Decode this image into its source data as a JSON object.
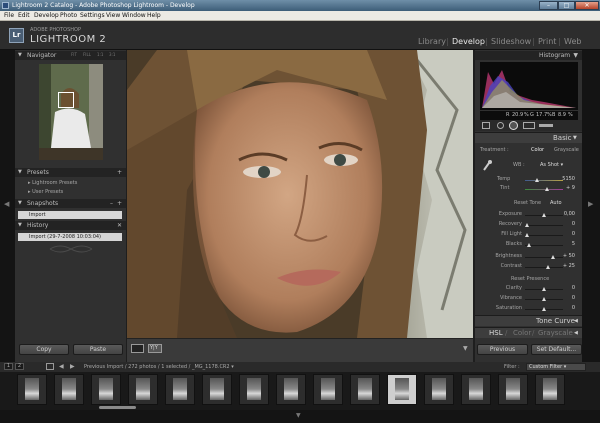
{
  "window": {
    "title": "Lightroom 2 Catalog - Adobe Photoshop Lightroom - Develop",
    "minimize": "–",
    "maximize": "□",
    "close": "✕"
  },
  "menu": [
    "File",
    "Edit",
    "Develop",
    "Photo",
    "Settings",
    "View",
    "Window",
    "Help"
  ],
  "identity": {
    "logo": "Lr",
    "vendor": "ADOBE PHOTOSHOP",
    "product": "LIGHTROOM 2"
  },
  "modules": [
    "Library",
    "Develop",
    "Slideshow",
    "Print",
    "Web"
  ],
  "module_separator": "|",
  "selected_module": "Develop",
  "left": {
    "navigator": {
      "title": "Navigator",
      "options": [
        "FIT",
        "FILL",
        "1:1",
        "3:1"
      ]
    },
    "presets": {
      "title": "Presets",
      "add": "+",
      "items": [
        "Lightroom Presets",
        "User Presets"
      ]
    },
    "snapshots": {
      "title": "Snapshots",
      "remove": "–",
      "add": "+",
      "items": [
        "Import"
      ]
    },
    "history": {
      "title": "History",
      "clear": "✕",
      "items": [
        "Import (29-7-2008 10:03:04)"
      ]
    },
    "copy_label": "Copy",
    "paste_label": "Paste"
  },
  "right": {
    "histogram": {
      "title": "Histogram",
      "r_label": "R",
      "r": "20.9",
      "g_label": "G",
      "g": "17.7",
      "b_label": "B",
      "b": "8.9",
      "pct": "%"
    },
    "basic": {
      "title": "Basic",
      "treatment_label": "Treatment :",
      "treatment_color": "Color",
      "treatment_gray": "Grayscale",
      "wb_label": "WB :",
      "wb_value": "As Shot",
      "temp_label": "Temp",
      "temp_value": "5150",
      "tint_label": "Tint",
      "tint_value": "+ 9",
      "tone_label": "Reset Tone",
      "auto_label": "Auto",
      "tone": [
        {
          "label": "Exposure",
          "value": "0,00",
          "level": 0.5
        },
        {
          "label": "Recovery",
          "value": "0",
          "level": 0.0
        },
        {
          "label": "Fill Light",
          "value": "0",
          "level": 0.0
        },
        {
          "label": "Blacks",
          "value": "5",
          "level": 0.05
        }
      ],
      "bc": [
        {
          "label": "Brightness",
          "value": "+ 50",
          "level": 0.75
        },
        {
          "label": "Contrast",
          "value": "+ 25",
          "level": 0.62
        }
      ],
      "presence_label": "Reset Presence",
      "presence": [
        {
          "label": "Clarity",
          "value": "0",
          "level": 0.5
        },
        {
          "label": "Vibrance",
          "value": "0",
          "level": 0.5
        },
        {
          "label": "Saturation",
          "value": "0",
          "level": 0.5
        }
      ]
    },
    "tone_curve": "Tone Curve",
    "hsl": {
      "hsl": "HSL",
      "color": "Color",
      "grayscale": "Grayscale",
      "divider": "/"
    },
    "previous_label": "Previous",
    "set_default_label": "Set Default..."
  },
  "filmstrip": {
    "page1": "1",
    "page2": "2",
    "nav_prev": "◀",
    "nav_next": "▶",
    "info": "Previous Import / 272 photos / 1 selected / _MG_1178.CR2",
    "info_menu": "▾",
    "filter_label": "Filter :",
    "filter_value": "Custom Filter",
    "filter_menu": "▾",
    "thumb_count": 15,
    "selected_index": 10
  },
  "colors": {
    "panel": "#303030",
    "header": "#232323",
    "accent_text": "#e9e9e9"
  }
}
